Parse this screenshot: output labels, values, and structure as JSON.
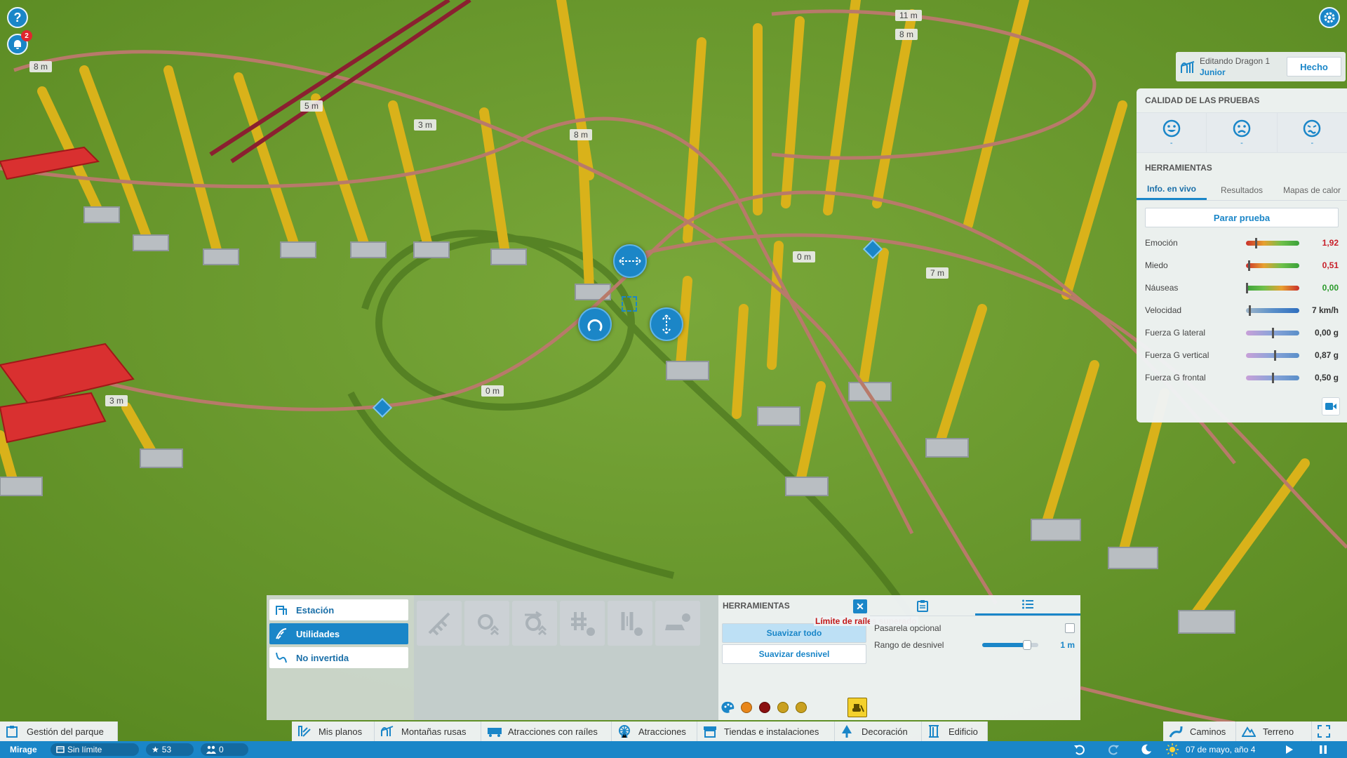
{
  "hud": {
    "help_icon": "?",
    "notification_count": "2"
  },
  "edit_header": {
    "editing_label": "Editando Dragon 1",
    "ride_name": "Junior",
    "done_label": "Hecho"
  },
  "test_panel": {
    "quality_title": "CALIDAD DE LAS PRUEBAS",
    "faces": [
      {
        "icon": "happy-face-icon",
        "value": "-"
      },
      {
        "icon": "sad-face-icon",
        "value": "-"
      },
      {
        "icon": "sick-face-icon",
        "value": "-"
      }
    ],
    "tools_title": "HERRAMIENTAS",
    "tabs": [
      "Info. en vivo",
      "Resultados",
      "Mapas de calor"
    ],
    "stop_button": "Parar prueba",
    "stats": [
      {
        "label": "Emoción",
        "value": "1,92",
        "level": 0.18,
        "color": "#c8202a",
        "bar": "rg"
      },
      {
        "label": "Miedo",
        "value": "0,51",
        "level": 0.04,
        "color": "#c8202a",
        "bar": "rg"
      },
      {
        "label": "Náuseas",
        "value": "0,00",
        "level": 0.0,
        "color": "#2a9a2a",
        "bar": "gr"
      },
      {
        "label": "Velocidad",
        "value": "7 km/h",
        "level": 0.06,
        "color": "#333333",
        "bar": "blue"
      },
      {
        "label": "Fuerza G lateral",
        "value": "0,00 g",
        "level": 0.5,
        "color": "#333333",
        "bar": "purple"
      },
      {
        "label": "Fuerza G vertical",
        "value": "0,87 g",
        "level": 0.55,
        "color": "#333333",
        "bar": "purple"
      },
      {
        "label": "Fuerza G frontal",
        "value": "0,50 g",
        "level": 0.5,
        "color": "#333333",
        "bar": "purple"
      }
    ]
  },
  "piece_types": [
    "Estación",
    "Utilidades",
    "No invertida"
  ],
  "tools_panel": {
    "title": "HERRAMIENTAS",
    "smooth_all": "Suavizar todo",
    "smooth_slope": "Suavizar desnivel",
    "warning": "Límite de raíles superado",
    "swatches": [
      "#e8861a",
      "#8a1010",
      "#c9a020",
      "#c9a020"
    ]
  },
  "options_panel": {
    "optional_label": "Pasarela opcional",
    "range_label": "Rango de desnivel",
    "range_value": "1 m",
    "range_level": 0.8
  },
  "scene_tags": [
    "8 m",
    "5 m",
    "3 m",
    "8 m",
    "11 m",
    "8 m",
    "0 m",
    "7 m",
    "3 m",
    "0 m"
  ],
  "menu": [
    "Gestión del parque",
    "Mis planos",
    "Montañas rusas",
    "Atracciones con raíles",
    "Atracciones",
    "Tiendas e instalaciones",
    "Decoración",
    "Edificio",
    "Caminos",
    "Terreno"
  ],
  "status": {
    "park_name": "Mirage",
    "money": "Sin límite",
    "rating": "53",
    "guests": "0",
    "date": "07 de mayo, año 4"
  }
}
